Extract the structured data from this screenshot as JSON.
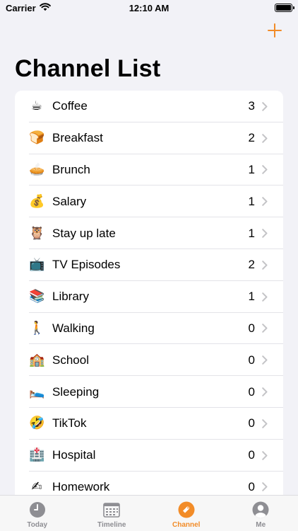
{
  "status_bar": {
    "carrier": "Carrier",
    "time": "12:10 AM"
  },
  "nav": {
    "title": "Channel List",
    "add_icon": "plus-icon",
    "accent_color": "#f28c28"
  },
  "channels": [
    {
      "emoji": "☕",
      "name": "Coffee",
      "count": "3"
    },
    {
      "emoji": "🍞",
      "name": "Breakfast",
      "count": "2"
    },
    {
      "emoji": "🥧",
      "name": "Brunch",
      "count": "1"
    },
    {
      "emoji": "💰",
      "name": "Salary",
      "count": "1"
    },
    {
      "emoji": "🦉",
      "name": "Stay up late",
      "count": "1"
    },
    {
      "emoji": "📺",
      "name": "TV Episodes",
      "count": "2"
    },
    {
      "emoji": "📚",
      "name": "Library",
      "count": "1"
    },
    {
      "emoji": "🚶",
      "name": "Walking",
      "count": "0"
    },
    {
      "emoji": "🏫",
      "name": "School",
      "count": "0"
    },
    {
      "emoji": "🛌",
      "name": "Sleeping",
      "count": "0"
    },
    {
      "emoji": "🤣",
      "name": "TikTok",
      "count": "0"
    },
    {
      "emoji": "🏥",
      "name": "Hospital",
      "count": "0"
    },
    {
      "emoji": "✍",
      "name": "Homework",
      "count": "0"
    }
  ],
  "tab_bar": {
    "tabs": [
      {
        "label": "Today",
        "icon": "clock-icon",
        "active": false
      },
      {
        "label": "Timeline",
        "icon": "calendar-icon",
        "active": false
      },
      {
        "label": "Channel",
        "icon": "tag-icon",
        "active": true
      },
      {
        "label": "Me",
        "icon": "person-icon",
        "active": false
      }
    ]
  }
}
